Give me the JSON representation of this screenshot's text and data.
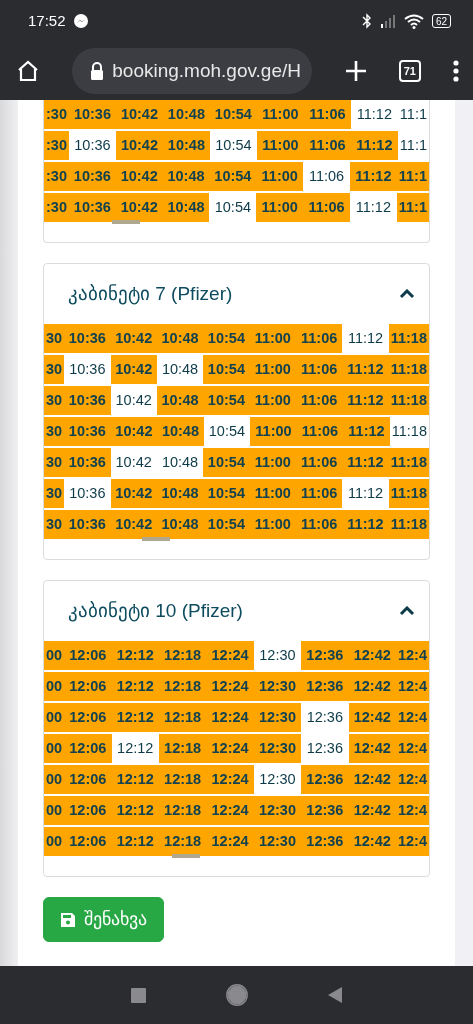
{
  "status_bar": {
    "time": "17:52",
    "battery": "62"
  },
  "browser": {
    "url": "booking.moh.gov.ge/H",
    "tab_count": "71"
  },
  "sections": [
    {
      "rows": [
        [
          {
            "text": ":30",
            "free": false
          },
          {
            "text": "10:36",
            "free": false
          },
          {
            "text": "10:42",
            "free": false
          },
          {
            "text": "10:48",
            "free": false
          },
          {
            "text": "10:54",
            "free": false
          },
          {
            "text": "11:00",
            "free": false
          },
          {
            "text": "11:06",
            "free": false
          },
          {
            "text": "11:12",
            "free": true
          },
          {
            "text": "11:1",
            "free": true
          }
        ],
        [
          {
            "text": ":30",
            "free": false
          },
          {
            "text": "10:36",
            "free": true
          },
          {
            "text": "10:42",
            "free": false
          },
          {
            "text": "10:48",
            "free": false
          },
          {
            "text": "10:54",
            "free": true
          },
          {
            "text": "11:00",
            "free": false
          },
          {
            "text": "11:06",
            "free": false
          },
          {
            "text": "11:12",
            "free": false
          },
          {
            "text": "11:1",
            "free": true
          }
        ],
        [
          {
            "text": ":30",
            "free": false
          },
          {
            "text": "10:36",
            "free": false
          },
          {
            "text": "10:42",
            "free": false
          },
          {
            "text": "10:48",
            "free": false
          },
          {
            "text": "10:54",
            "free": false
          },
          {
            "text": "11:00",
            "free": false
          },
          {
            "text": "11:06",
            "free": true
          },
          {
            "text": "11:12",
            "free": false
          },
          {
            "text": "11:1",
            "free": false
          }
        ],
        [
          {
            "text": ":30",
            "free": false
          },
          {
            "text": "10:36",
            "free": false
          },
          {
            "text": "10:42",
            "free": false
          },
          {
            "text": "10:48",
            "free": false
          },
          {
            "text": "10:54",
            "free": true
          },
          {
            "text": "11:00",
            "free": false
          },
          {
            "text": "11:06",
            "free": false
          },
          {
            "text": "11:12",
            "free": true
          },
          {
            "text": "11:1",
            "free": false
          }
        ]
      ]
    },
    {
      "title": "კაბინეტი 7 (Pfizer)",
      "expanded": true,
      "rows": [
        [
          {
            "text": "30",
            "free": false
          },
          {
            "text": "10:36",
            "free": false
          },
          {
            "text": "10:42",
            "free": false
          },
          {
            "text": "10:48",
            "free": false
          },
          {
            "text": "10:54",
            "free": false
          },
          {
            "text": "11:00",
            "free": false
          },
          {
            "text": "11:06",
            "free": false
          },
          {
            "text": "11:12",
            "free": true
          },
          {
            "text": "11:18",
            "free": false
          }
        ],
        [
          {
            "text": "30",
            "free": false
          },
          {
            "text": "10:36",
            "free": true
          },
          {
            "text": "10:42",
            "free": false
          },
          {
            "text": "10:48",
            "free": true
          },
          {
            "text": "10:54",
            "free": false
          },
          {
            "text": "11:00",
            "free": false
          },
          {
            "text": "11:06",
            "free": false
          },
          {
            "text": "11:12",
            "free": false
          },
          {
            "text": "11:18",
            "free": false
          }
        ],
        [
          {
            "text": "30",
            "free": false
          },
          {
            "text": "10:36",
            "free": false
          },
          {
            "text": "10:42",
            "free": true
          },
          {
            "text": "10:48",
            "free": false
          },
          {
            "text": "10:54",
            "free": false
          },
          {
            "text": "11:00",
            "free": false
          },
          {
            "text": "11:06",
            "free": false
          },
          {
            "text": "11:12",
            "free": false
          },
          {
            "text": "11:18",
            "free": false
          }
        ],
        [
          {
            "text": "30",
            "free": false
          },
          {
            "text": "10:36",
            "free": false
          },
          {
            "text": "10:42",
            "free": false
          },
          {
            "text": "10:48",
            "free": false
          },
          {
            "text": "10:54",
            "free": true
          },
          {
            "text": "11:00",
            "free": false
          },
          {
            "text": "11:06",
            "free": false
          },
          {
            "text": "11:12",
            "free": false
          },
          {
            "text": "11:18",
            "free": true
          }
        ],
        [
          {
            "text": "30",
            "free": false
          },
          {
            "text": "10:36",
            "free": false
          },
          {
            "text": "10:42",
            "free": true
          },
          {
            "text": "10:48",
            "free": true
          },
          {
            "text": "10:54",
            "free": false
          },
          {
            "text": "11:00",
            "free": false
          },
          {
            "text": "11:06",
            "free": false
          },
          {
            "text": "11:12",
            "free": false
          },
          {
            "text": "11:18",
            "free": false
          }
        ],
        [
          {
            "text": "30",
            "free": false
          },
          {
            "text": "10:36",
            "free": true
          },
          {
            "text": "10:42",
            "free": false
          },
          {
            "text": "10:48",
            "free": false
          },
          {
            "text": "10:54",
            "free": false
          },
          {
            "text": "11:00",
            "free": false
          },
          {
            "text": "11:06",
            "free": false
          },
          {
            "text": "11:12",
            "free": true
          },
          {
            "text": "11:18",
            "free": false
          }
        ],
        [
          {
            "text": "30",
            "free": false
          },
          {
            "text": "10:36",
            "free": false
          },
          {
            "text": "10:42",
            "free": false
          },
          {
            "text": "10:48",
            "free": false
          },
          {
            "text": "10:54",
            "free": false
          },
          {
            "text": "11:00",
            "free": false
          },
          {
            "text": "11:06",
            "free": false
          },
          {
            "text": "11:12",
            "free": false
          },
          {
            "text": "11:18",
            "free": false
          }
        ]
      ]
    },
    {
      "title": "კაბინეტი 10 (Pfizer)",
      "expanded": true,
      "rows": [
        [
          {
            "text": "00",
            "free": false
          },
          {
            "text": "12:06",
            "free": false
          },
          {
            "text": "12:12",
            "free": false
          },
          {
            "text": "12:18",
            "free": false
          },
          {
            "text": "12:24",
            "free": false
          },
          {
            "text": "12:30",
            "free": true
          },
          {
            "text": "12:36",
            "free": false
          },
          {
            "text": "12:42",
            "free": false
          },
          {
            "text": "12:4",
            "free": false
          }
        ],
        [
          {
            "text": "00",
            "free": false
          },
          {
            "text": "12:06",
            "free": false
          },
          {
            "text": "12:12",
            "free": false
          },
          {
            "text": "12:18",
            "free": false
          },
          {
            "text": "12:24",
            "free": false
          },
          {
            "text": "12:30",
            "free": false
          },
          {
            "text": "12:36",
            "free": false
          },
          {
            "text": "12:42",
            "free": false
          },
          {
            "text": "12:4",
            "free": false
          }
        ],
        [
          {
            "text": "00",
            "free": false
          },
          {
            "text": "12:06",
            "free": false
          },
          {
            "text": "12:12",
            "free": false
          },
          {
            "text": "12:18",
            "free": false
          },
          {
            "text": "12:24",
            "free": false
          },
          {
            "text": "12:30",
            "free": false
          },
          {
            "text": "12:36",
            "free": true
          },
          {
            "text": "12:42",
            "free": false
          },
          {
            "text": "12:4",
            "free": false
          }
        ],
        [
          {
            "text": "00",
            "free": false
          },
          {
            "text": "12:06",
            "free": false
          },
          {
            "text": "12:12",
            "free": true
          },
          {
            "text": "12:18",
            "free": false
          },
          {
            "text": "12:24",
            "free": false
          },
          {
            "text": "12:30",
            "free": false
          },
          {
            "text": "12:36",
            "free": true
          },
          {
            "text": "12:42",
            "free": false
          },
          {
            "text": "12:4",
            "free": false
          }
        ],
        [
          {
            "text": "00",
            "free": false
          },
          {
            "text": "12:06",
            "free": false
          },
          {
            "text": "12:12",
            "free": false
          },
          {
            "text": "12:18",
            "free": false
          },
          {
            "text": "12:24",
            "free": false
          },
          {
            "text": "12:30",
            "free": true
          },
          {
            "text": "12:36",
            "free": false
          },
          {
            "text": "12:42",
            "free": false
          },
          {
            "text": "12:4",
            "free": false
          }
        ],
        [
          {
            "text": "00",
            "free": false
          },
          {
            "text": "12:06",
            "free": false
          },
          {
            "text": "12:12",
            "free": false
          },
          {
            "text": "12:18",
            "free": false
          },
          {
            "text": "12:24",
            "free": false
          },
          {
            "text": "12:30",
            "free": false
          },
          {
            "text": "12:36",
            "free": false
          },
          {
            "text": "12:42",
            "free": false
          },
          {
            "text": "12:4",
            "free": false
          }
        ],
        [
          {
            "text": "00",
            "free": false
          },
          {
            "text": "12:06",
            "free": false
          },
          {
            "text": "12:12",
            "free": false
          },
          {
            "text": "12:18",
            "free": false
          },
          {
            "text": "12:24",
            "free": false
          },
          {
            "text": "12:30",
            "free": false
          },
          {
            "text": "12:36",
            "free": false
          },
          {
            "text": "12:42",
            "free": false
          },
          {
            "text": "12:4",
            "free": false
          }
        ]
      ]
    }
  ],
  "save_button": {
    "label": "შენახვა"
  }
}
